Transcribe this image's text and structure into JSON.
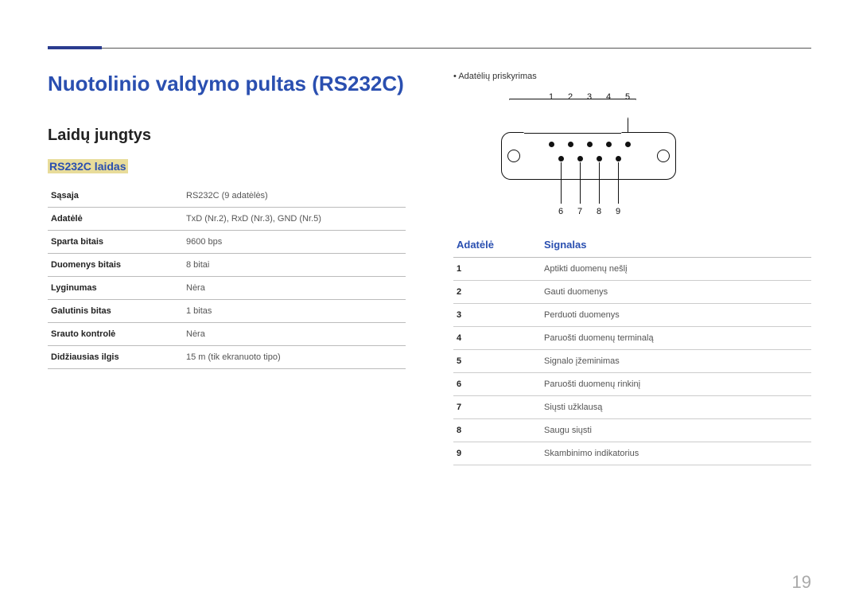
{
  "page_number": "19",
  "title": "Nuotolinio valdymo pultas (RS232C)",
  "section": "Laidų jungtys",
  "sub": "RS232C laidas",
  "spec_rows": [
    {
      "k": "Sąsaja",
      "v": "RS232C (9 adatėlės)"
    },
    {
      "k": "Adatėlė",
      "v": "TxD (Nr.2), RxD (Nr.3), GND (Nr.5)"
    },
    {
      "k": "Sparta bitais",
      "v": "9600 bps"
    },
    {
      "k": "Duomenys bitais",
      "v": "8 bitai"
    },
    {
      "k": "Lyginumas",
      "v": "Nėra"
    },
    {
      "k": "Galutinis bitas",
      "v": "1 bitas"
    },
    {
      "k": "Srauto kontrolė",
      "v": "Nėra"
    },
    {
      "k": "Didžiausias ilgis",
      "v": "15 m (tik ekranuoto tipo)"
    }
  ],
  "bullet": "Adatėlių priskyrimas",
  "pin_top": [
    "1",
    "2",
    "3",
    "4",
    "5"
  ],
  "pin_bot": [
    "6",
    "7",
    "8",
    "9"
  ],
  "sig_header": {
    "a": "Adatėlė",
    "b": "Signalas"
  },
  "sig_rows": [
    {
      "n": "1",
      "s": "Aptikti duomenų nešlį"
    },
    {
      "n": "2",
      "s": "Gauti duomenys"
    },
    {
      "n": "3",
      "s": "Perduoti duomenys"
    },
    {
      "n": "4",
      "s": "Paruošti duomenų terminalą"
    },
    {
      "n": "5",
      "s": "Signalo įžeminimas"
    },
    {
      "n": "6",
      "s": "Paruošti duomenų rinkinį"
    },
    {
      "n": "7",
      "s": "Siųsti užklausą"
    },
    {
      "n": "8",
      "s": "Saugu siųsti"
    },
    {
      "n": "9",
      "s": "Skambinimo indikatorius"
    }
  ]
}
